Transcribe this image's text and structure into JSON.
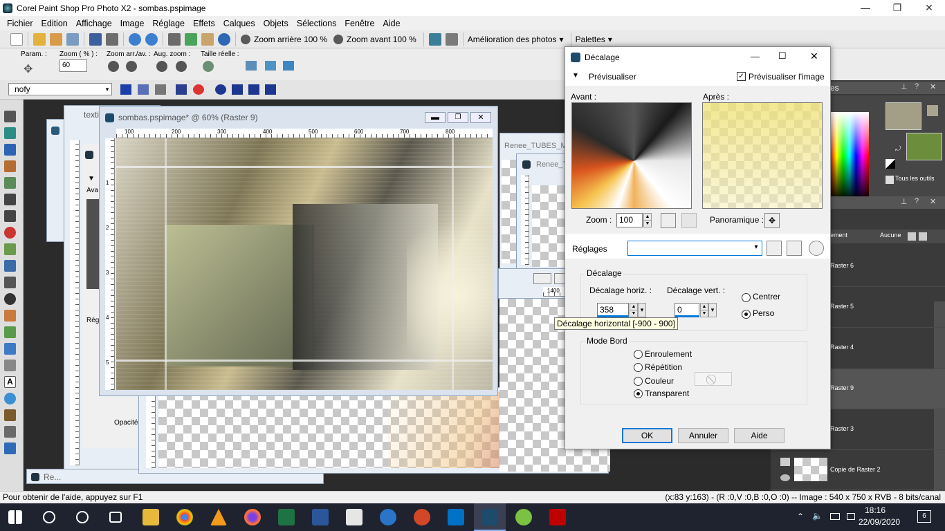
{
  "window": {
    "title": "Corel Paint Shop Pro Photo X2 - sombas.pspimage",
    "minimize": "—",
    "restore": "❐",
    "close": "✕"
  },
  "menu": [
    "Fichier",
    "Edition",
    "Affichage",
    "Image",
    "Réglage",
    "Effets",
    "Calques",
    "Objets",
    "Sélections",
    "Fenêtre",
    "Aide"
  ],
  "toolbar": {
    "zoom_out": "Zoom arrière 100 %",
    "zoom_in": "Zoom avant 100 %",
    "enhance": "Amélioration des photos",
    "palettes": "Palettes"
  },
  "tool_options": {
    "param": "Param. :",
    "zoom_pct": "Zoom ( % ) :",
    "zoom_value": "60",
    "zoom_arr": "Zoom arr./av. :",
    "aug_zoom": "Aug. zoom :",
    "real_size": "Taille réelle :"
  },
  "script_bar": {
    "script_name": "nofy"
  },
  "documents": {
    "main_title": "sombas.pspimage* @  60% (Raster 9)",
    "back_title_1": "texti",
    "back_title_2": "Renee_TUBES_M",
    "back_title_3": "Renee_T",
    "back_title_4": "Re...",
    "ruler_h": [
      "100",
      "200",
      "300",
      "400",
      "500",
      "600",
      "700",
      "800"
    ],
    "ruler_v": [
      "1",
      "2",
      "3",
      "4",
      "5"
    ],
    "side_labels": {
      "avant": "Ava",
      "reg": "Rég",
      "opacity": "Opacité",
      "ruler_1400": "1400"
    }
  },
  "right_panel": {
    "materials_header": "es",
    "all_tools": "Tous les outils",
    "layers_toolbar": {
      "element": "ement",
      "none": "Aucune"
    },
    "layers": [
      "Raster 6",
      "Raster 5",
      "Raster 4",
      "Raster 9",
      "Raster 3",
      "Copie de Raster 2"
    ]
  },
  "dialog": {
    "title": "Décalage",
    "preview_toggle": "Prévisualiser",
    "preview_image": "Prévisualiser l'image",
    "before": "Avant :",
    "after": "Après :",
    "zoom_label": "Zoom :",
    "zoom_value": "100",
    "pan_label": "Panoramique :",
    "settings_label": "Réglages",
    "offset_group": "Décalage",
    "horiz_label": "Décalage horiz. :",
    "horiz_value": "358",
    "vert_label": "Décalage vert. :",
    "vert_value": "0",
    "center": "Centrer",
    "custom": "Perso",
    "edge_group": "Mode Bord",
    "wrap": "Enroulement",
    "repeat": "Répétition",
    "color": "Couleur",
    "transparent": "Transparent",
    "ok": "OK",
    "cancel": "Annuler",
    "help": "Aide"
  },
  "tooltip": "Décalage horizontal [-900 - 900]",
  "status": {
    "help": "Pour obtenir de l'aide, appuyez sur F1",
    "info": "(x:83 y:163) - (R :0,V :0,B :0,O :0) -- Image :  540 x 750 x RVB - 8 bits/canal"
  },
  "taskbar": {
    "time": "18:16",
    "date": "22/09/2020",
    "notif": "6"
  },
  "colors": {
    "accent": "#0078d7",
    "taskbar": "#1f2330",
    "foreground_swatch": "#a39f86",
    "background_swatch": "#6b8d3c"
  }
}
